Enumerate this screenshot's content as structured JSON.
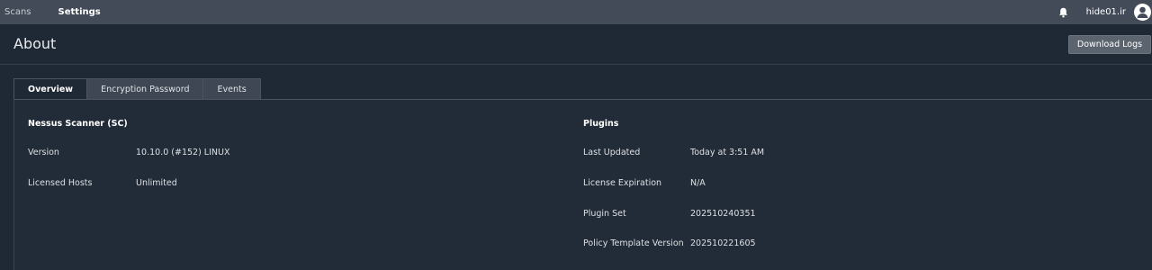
{
  "nav": {
    "items": [
      {
        "label": "Scans"
      },
      {
        "label": "Settings"
      }
    ],
    "username": "hide01.ir"
  },
  "header": {
    "title": "About",
    "download_logs_label": "Download Logs"
  },
  "tabs": [
    {
      "label": "Overview",
      "active": true
    },
    {
      "label": "Encryption Password",
      "active": false
    },
    {
      "label": "Events",
      "active": false
    }
  ],
  "scanner": {
    "title": "Nessus Scanner (SC)",
    "fields": [
      {
        "label": "Version",
        "value": "10.10.0 (#152) LINUX"
      },
      {
        "label": "Licensed Hosts",
        "value": "Unlimited"
      }
    ]
  },
  "plugins": {
    "title": "Plugins",
    "fields": [
      {
        "label": "Last Updated",
        "value": "Today at 3:51 AM"
      },
      {
        "label": "License Expiration",
        "value": "N/A"
      },
      {
        "label": "Plugin Set",
        "value": "202510240351"
      },
      {
        "label": "Policy Template Version",
        "value": "202510221605"
      }
    ]
  },
  "icons": {
    "bell": "bell-icon",
    "avatar": "user-avatar-icon"
  },
  "colors": {
    "topbar": "#424b57",
    "background": "#1f2835",
    "button": "#5b646f"
  }
}
